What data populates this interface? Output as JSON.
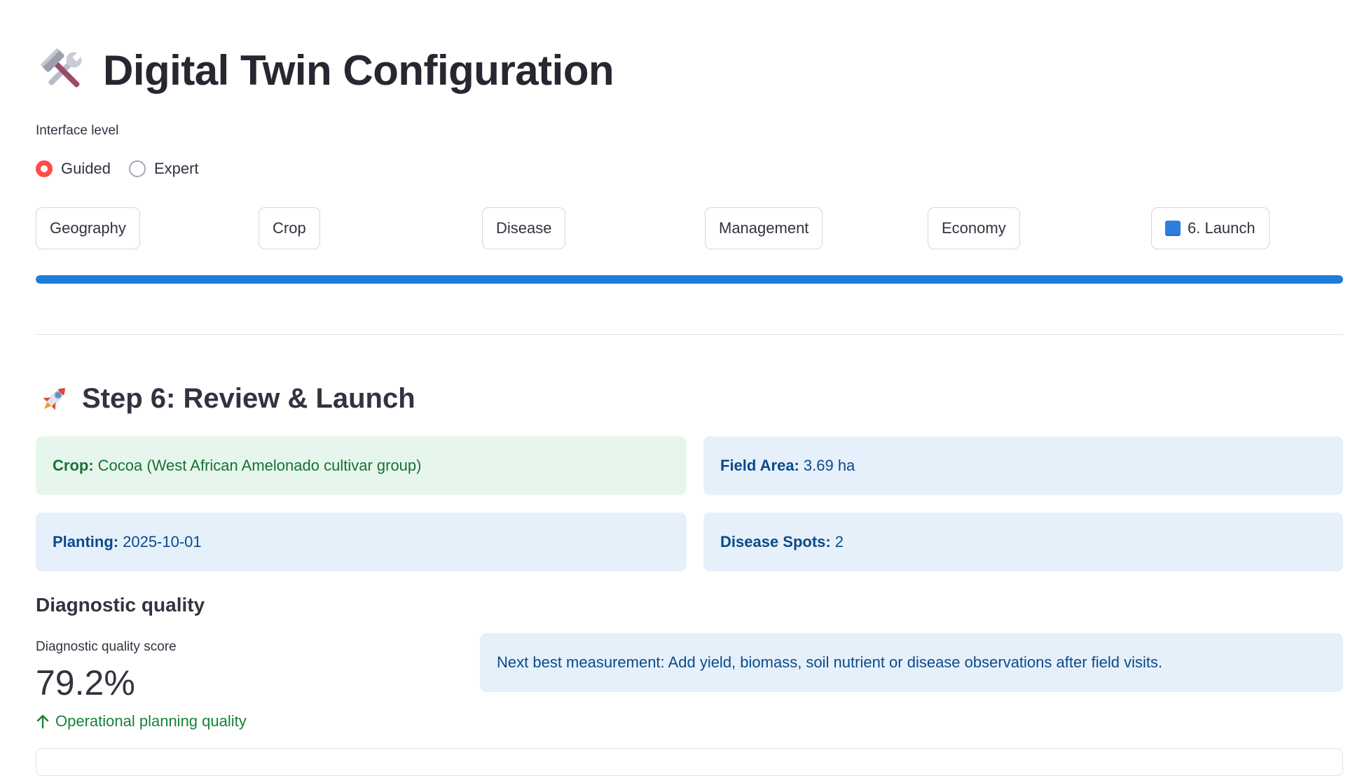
{
  "header": {
    "title": "Digital Twin Configuration",
    "title_icon": "hammer-wrench-icon"
  },
  "interface": {
    "label": "Interface level",
    "options": [
      "Guided",
      "Expert"
    ],
    "selected": "Guided"
  },
  "steps": [
    {
      "label": "Geography"
    },
    {
      "label": "Crop"
    },
    {
      "label": "Disease"
    },
    {
      "label": "Management"
    },
    {
      "label": "Economy"
    },
    {
      "label": "6. Launch",
      "icon": "blue-square-icon",
      "current": true
    }
  ],
  "progress": {
    "fraction": 1.0,
    "color": "#1c7ed6"
  },
  "review": {
    "title": "Step 6: Review & Launch",
    "icon": "rocket-icon",
    "crop_label": "Crop:",
    "crop_value": "Cocoa (West African Amelonado cultivar group)",
    "area_label": "Field Area:",
    "area_value": "3.69 ha",
    "planting_label": "Planting:",
    "planting_value": "2025-10-01",
    "spots_label": "Disease Spots:",
    "spots_value": "2"
  },
  "diagnostic": {
    "title": "Diagnostic quality",
    "metric_label": "Diagnostic quality score",
    "metric_value": "79.2%",
    "delta": "Operational planning quality",
    "next_measurement": "Next best measurement: Add yield, biomass, soil nutrient or disease observations after field visits."
  },
  "colors": {
    "accent_red": "#ff4b4b",
    "success_bg": "#e6f6ec",
    "info_bg": "#e6f0fb",
    "success_text": "#177233",
    "info_text": "#0b4a8a"
  }
}
